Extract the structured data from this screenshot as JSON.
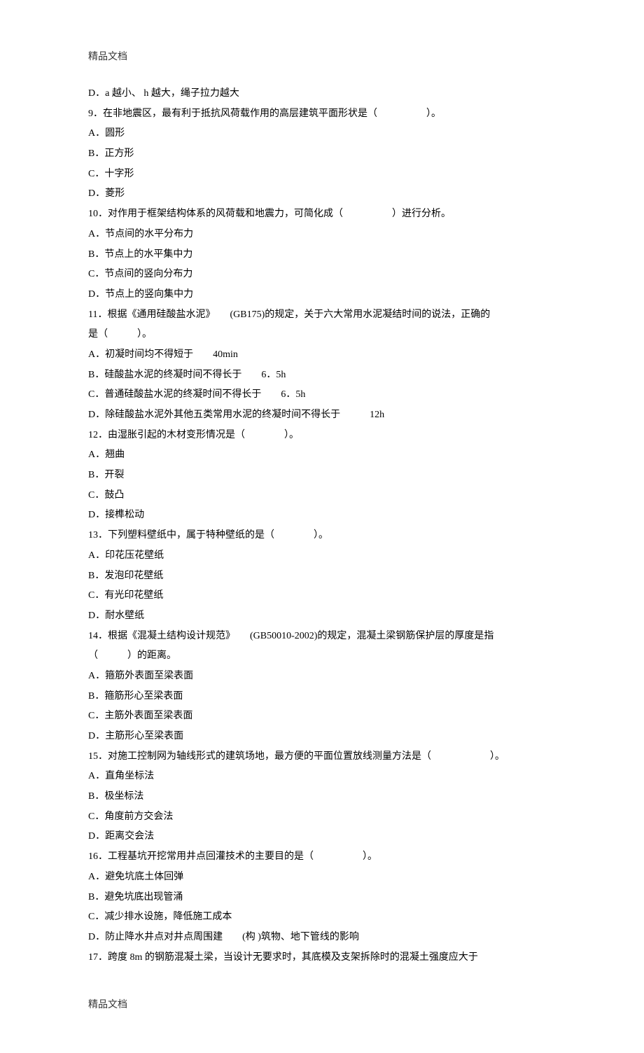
{
  "header": "精品文档",
  "footer": "精品文档",
  "lines": [
    "D．a 越小、 h 越大，绳子拉力越大",
    "9．在非地震区，最有利于抵抗风荷载作用的高层建筑平面形状是（　　　　　）。",
    "A．圆形",
    "B．正方形",
    "C．十字形",
    "D．菱形",
    "10．对作用于框架结构体系的风荷载和地震力，可简化成（　　　　　）进行分析。",
    "A．节点间的水平分布力",
    "B．节点上的水平集中力",
    "C．节点间的竖向分布力",
    "D．节点上的竖向集中力",
    "11．根据《通用硅酸盐水泥》　　(GB175)的规定，关于六大常用水泥凝结时间的说法，正确的",
    "是（　　　）。",
    "A．初凝时间均不得短于　　40min",
    "B．硅酸盐水泥的终凝时间不得长于　　6．5h",
    "C．普通硅酸盐水泥的终凝时间不得长于　　6．5h",
    "D．除硅酸盐水泥外其他五类常用水泥的终凝时间不得长于　　　12h",
    "12．由湿胀引起的木材变形情况是（　　　　）。",
    "A．翘曲",
    "B．开裂",
    "C．鼓凸",
    "D．接榫松动",
    "13．下列塑料壁纸中，属于特种壁纸的是（　　　　）。",
    "A．印花压花壁纸",
    "B．发泡印花壁纸",
    "C．有光印花壁纸",
    "D．耐水壁纸",
    "14．根据《混凝土结构设计规范》　　(GB50010-2002)的规定，混凝土梁钢筋保护层的厚度是指",
    "（　　　）的距离。",
    "A．箍筋外表面至梁表面",
    "B．箍筋形心至梁表面",
    "C．主筋外表面至梁表面",
    "D．主筋形心至梁表面",
    "15．对施工控制网为轴线形式的建筑场地，最方便的平面位置放线测量方法是（　　　　　　）。",
    "A．直角坐标法",
    "B．极坐标法",
    "C．角度前方交会法",
    "D．距离交会法",
    "16．工程基坑开挖常用井点回灌技术的主要目的是（　　　　　）。",
    "A．避免坑底土体回弹",
    "B．避免坑底出现管涌",
    "C．减少排水设施，降低施工成本",
    "D．防止降水井点对井点周围建　　(构 )筑物、地下管线的影响",
    "17．跨度 8m 的钢筋混凝土梁，当设计无要求时，其底模及支架拆除时的混凝土强度应大于"
  ]
}
